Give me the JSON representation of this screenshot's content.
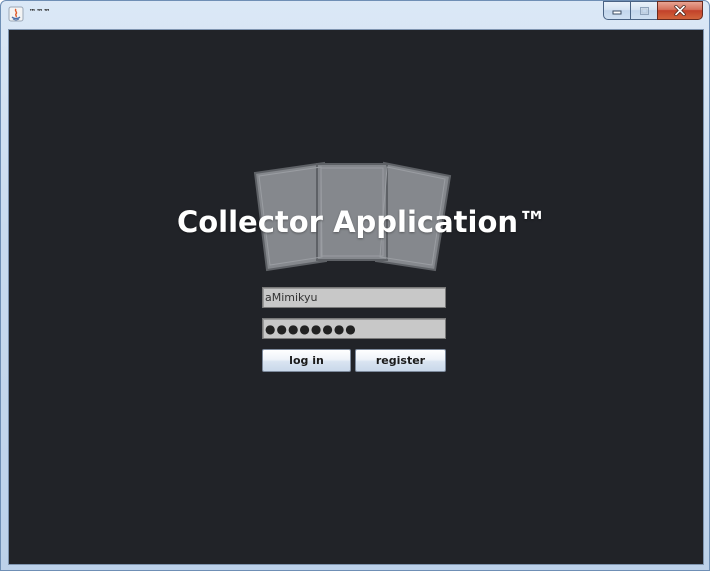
{
  "window": {
    "title": "™™™"
  },
  "main": {
    "app_title": "Collector Application™",
    "username_value": "aMimikyu",
    "password_value": "●●●●●●●●",
    "login_label": "log in",
    "register_label": "register"
  },
  "icons": {
    "app": "java-icon",
    "minimize": "minimize-icon",
    "maximize": "maximize-icon",
    "close": "close-icon",
    "logo": "card-fan-logo"
  },
  "colors": {
    "background": "#212328",
    "title_text": "#ffffff",
    "card_fill": "#8c8f94",
    "field_bg": "#c8c8c8"
  }
}
